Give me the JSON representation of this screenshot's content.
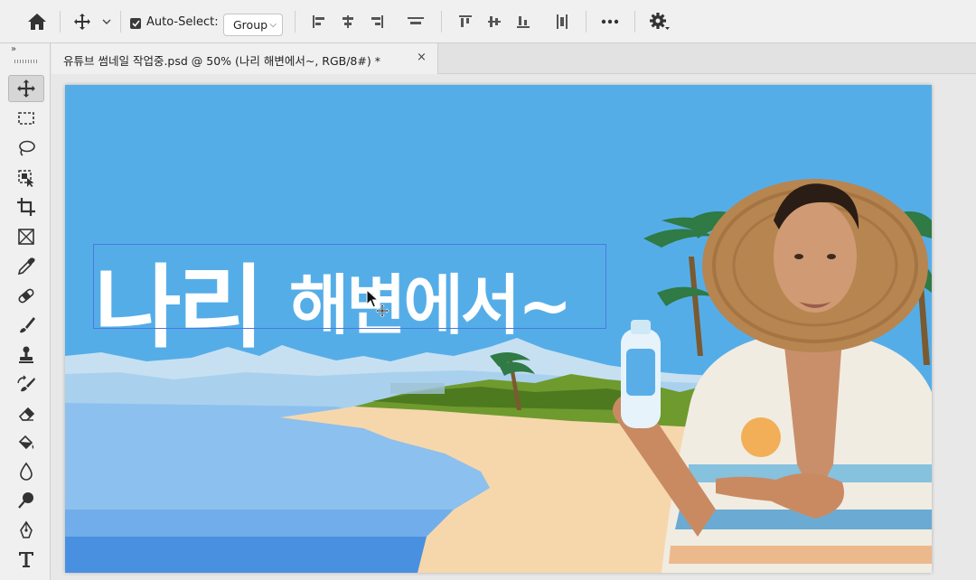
{
  "options_bar": {
    "auto_select_label": "Auto-Select:",
    "auto_select_checked": true,
    "select_value": "Group"
  },
  "document": {
    "tab_title": "유튜브 썸네일 작업중.psd @ 50% (나리 해변에서~, RGB/8#) *",
    "close_glyph": "×"
  },
  "canvas": {
    "headline_word1": "나리",
    "headline_word2": "해변에서~"
  },
  "colors": {
    "sky": "#55ade8",
    "sea": "#8cc0ee",
    "sand": "#f6d7ac",
    "selection": "#4a78e0"
  }
}
